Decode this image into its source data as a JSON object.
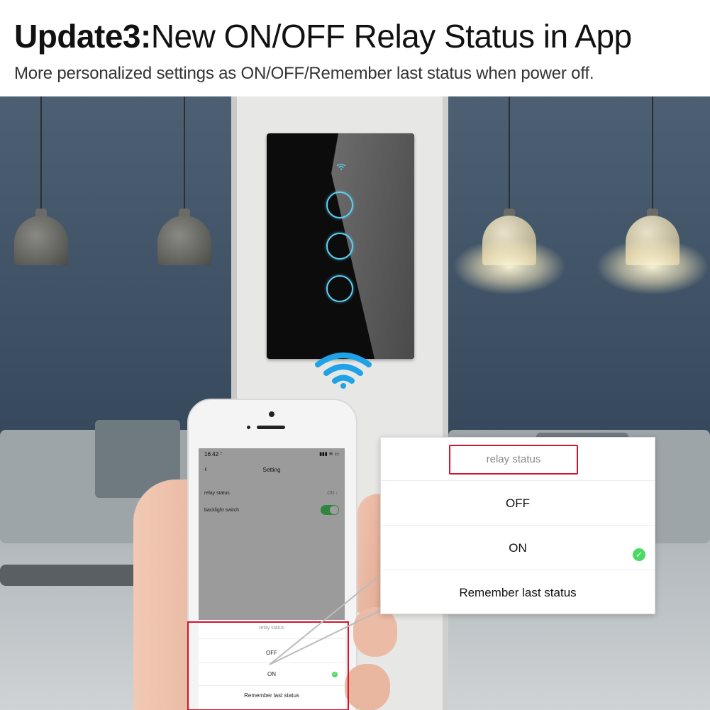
{
  "header": {
    "title_bold": "Update3:",
    "title_rest": "New ON/OFF Relay Status in App",
    "subtitle": "More personalized settings as ON/OFF/Remember last status when power off."
  },
  "phone": {
    "status_time": "16:42 ⁷",
    "status_icons": "▮▮▮ ≋ ▭",
    "nav_back": "‹",
    "nav_title": "Setting",
    "rows": [
      {
        "label": "relay status",
        "value": "ON ›"
      },
      {
        "label": "backlight switch",
        "value": ""
      }
    ],
    "backlight_on": true,
    "sheet": {
      "title": "relay status",
      "options": [
        "OFF",
        "ON",
        "Remember last status"
      ],
      "selected": "ON"
    }
  },
  "popup": {
    "title": "relay status",
    "options": [
      "OFF",
      "ON",
      "Remember last status"
    ],
    "selected": "ON",
    "check_icon": "✓"
  },
  "colors": {
    "accent_green": "#4cd964",
    "highlight_red": "#d0152c",
    "touch_blue": "#5fd0f5"
  }
}
